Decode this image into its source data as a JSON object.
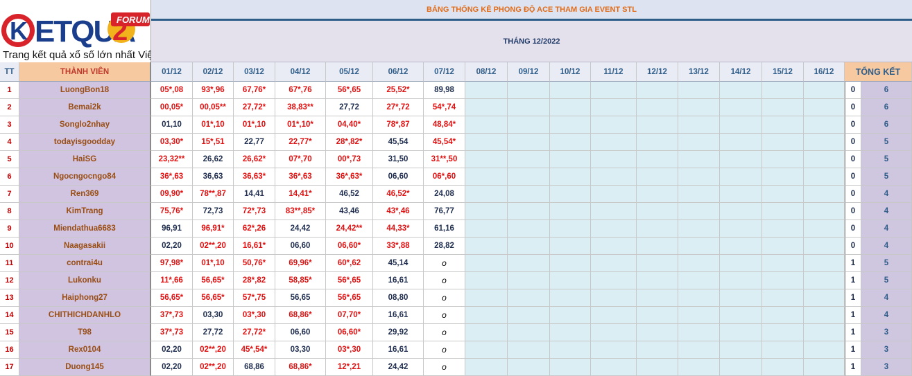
{
  "logo": {
    "brand": "KETQUA2",
    "badge": "FORUM",
    "tagline": "Trang kết quả xổ số lớn nhất Việt Nam"
  },
  "title": "BẢNG THỐNG KÊ PHONG ĐỘ ACE THAM GIA EVENT STL",
  "month": "THÁNG 12/2022",
  "headers": {
    "tt": "TT",
    "member": "THÀNH VIÊN",
    "dates": [
      "01/12",
      "02/12",
      "03/12",
      "04/12",
      "05/12",
      "06/12",
      "07/12",
      "08/12",
      "09/12",
      "10/12",
      "11/12",
      "12/12",
      "13/12",
      "14/12",
      "15/12",
      "16/12"
    ],
    "total": "TỔNG KẾT"
  },
  "rows": [
    {
      "tt": "1",
      "name": "LuongBon18",
      "days": [
        "05*,08",
        "93*,96",
        "67,76*",
        "67*,76",
        "56*,65",
        "25,52*",
        "89,98"
      ],
      "hits": "0",
      "total": "6"
    },
    {
      "tt": "2",
      "name": "Bemai2k",
      "days": [
        "00,05*",
        "00,05**",
        "27,72*",
        "38,83**",
        "27,72",
        "27*,72",
        "54*,74"
      ],
      "hits": "0",
      "total": "6"
    },
    {
      "tt": "3",
      "name": "Songlo2nhay",
      "days": [
        "01,10",
        "01*,10",
        "01*,10",
        "01*,10*",
        "04,40*",
        "78*,87",
        "48,84*"
      ],
      "hits": "0",
      "total": "6"
    },
    {
      "tt": "4",
      "name": "todayisgoodday",
      "days": [
        "03,30*",
        "15*,51",
        "22,77",
        "22,77*",
        "28*,82*",
        "45,54",
        "45,54*"
      ],
      "hits": "0",
      "total": "5"
    },
    {
      "tt": "5",
      "name": "HaiSG",
      "days": [
        "23,32**",
        "26,62",
        "26,62*",
        "07*,70",
        "00*,73",
        "31,50",
        "31**,50"
      ],
      "hits": "0",
      "total": "5"
    },
    {
      "tt": "6",
      "name": "Ngocngocngo84",
      "days": [
        "36*,63",
        "36,63",
        "36,63*",
        "36*,63",
        "36*,63*",
        "06,60",
        "06*,60"
      ],
      "hits": "0",
      "total": "5"
    },
    {
      "tt": "7",
      "name": "Ren369",
      "days": [
        "09,90*",
        "78**,87",
        "14,41",
        "14,41*",
        "46,52",
        "46,52*",
        "24,08"
      ],
      "hits": "0",
      "total": "4"
    },
    {
      "tt": "8",
      "name": "KimTrang",
      "days": [
        "75,76*",
        "72,73",
        "72*,73",
        "83**,85*",
        "43,46",
        "43*,46",
        "76,77"
      ],
      "hits": "0",
      "total": "4"
    },
    {
      "tt": "9",
      "name": "Miendathua6683",
      "days": [
        "96,91",
        "96,91*",
        "62*,26",
        "24,42",
        "24,42**",
        "44,33*",
        "61,16"
      ],
      "hits": "0",
      "total": "4"
    },
    {
      "tt": "10",
      "name": "Naagasakii",
      "days": [
        "02,20",
        "02**,20",
        "16,61*",
        "06,60",
        "06,60*",
        "33*,88",
        "28,82"
      ],
      "hits": "0",
      "total": "4"
    },
    {
      "tt": "11",
      "name": "contrai4u",
      "days": [
        "97,98*",
        "01*,10",
        "50,76*",
        "69,96*",
        "60*,62",
        "45,14",
        "o"
      ],
      "hits": "1",
      "total": "5"
    },
    {
      "tt": "12",
      "name": "Lukonku",
      "days": [
        "11*,66",
        "56,65*",
        "28*,82",
        "58,85*",
        "56*,65",
        "16,61",
        "o"
      ],
      "hits": "1",
      "total": "5"
    },
    {
      "tt": "13",
      "name": "Haiphong27",
      "days": [
        "56,65*",
        "56,65*",
        "57*,75",
        "56,65",
        "56*,65",
        "08,80",
        "o"
      ],
      "hits": "1",
      "total": "4"
    },
    {
      "tt": "14",
      "name": "CHITHICHDANHLO",
      "days": [
        "37*,73",
        "03,30",
        "03*,30",
        "68,86*",
        "07,70*",
        "16,61",
        "o"
      ],
      "hits": "1",
      "total": "4"
    },
    {
      "tt": "15",
      "name": "T98",
      "days": [
        "37*,73",
        "27,72",
        "27,72*",
        "06,60",
        "06,60*",
        "29,92",
        "o"
      ],
      "hits": "1",
      "total": "3"
    },
    {
      "tt": "16",
      "name": "Rex0104",
      "days": [
        "02,20",
        "02**,20",
        "45*,54*",
        "03,30",
        "03*,30",
        "16,61",
        "o"
      ],
      "hits": "1",
      "total": "3"
    },
    {
      "tt": "17",
      "name": "Duong145",
      "days": [
        "02,20",
        "02**,20",
        "68,86",
        "68,86*",
        "12*,21",
        "24,42",
        "o"
      ],
      "hits": "1",
      "total": "3"
    }
  ],
  "colors": {
    "hit": "#e11010",
    "miss": "#1f2d4f",
    "title": "#e06c1a",
    "empty": "#daeef3",
    "member_bg": "#d0c4e0",
    "header_bg": "#f7c9a0"
  }
}
